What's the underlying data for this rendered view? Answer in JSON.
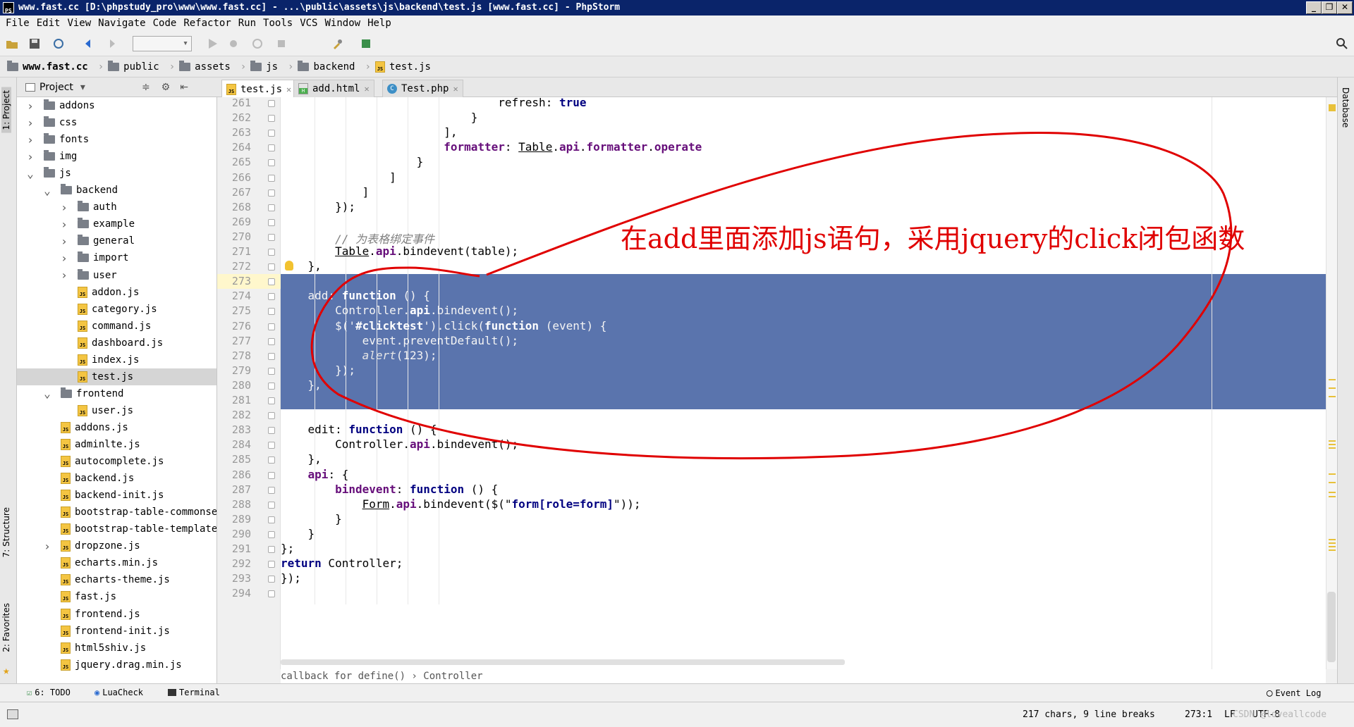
{
  "window": {
    "title": "www.fast.cc [D:\\phpstudy_pro\\www\\www.fast.cc] - ...\\public\\assets\\js\\backend\\test.js [www.fast.cc] - PhpStorm",
    "buttons": [
      "_",
      "❐",
      "✕"
    ]
  },
  "menu": [
    "File",
    "Edit",
    "View",
    "Navigate",
    "Code",
    "Refactor",
    "Run",
    "Tools",
    "VCS",
    "Window",
    "Help"
  ],
  "breadcrumbs": [
    "www.fast.cc",
    "public",
    "assets",
    "js",
    "backend",
    "test.js"
  ],
  "project_panel": {
    "title": "Project",
    "tree": [
      {
        "label": "addons",
        "type": "folder",
        "depth": 0,
        "arrow": "›"
      },
      {
        "label": "css",
        "type": "folder",
        "depth": 0,
        "arrow": "›"
      },
      {
        "label": "fonts",
        "type": "folder",
        "depth": 0,
        "arrow": "›"
      },
      {
        "label": "img",
        "type": "folder",
        "depth": 0,
        "arrow": "›"
      },
      {
        "label": "js",
        "type": "folder",
        "depth": 0,
        "arrow": "⌄"
      },
      {
        "label": "backend",
        "type": "folder",
        "depth": 1,
        "arrow": "⌄"
      },
      {
        "label": "auth",
        "type": "folder",
        "depth": 2,
        "arrow": "›"
      },
      {
        "label": "example",
        "type": "folder",
        "depth": 2,
        "arrow": "›"
      },
      {
        "label": "general",
        "type": "folder",
        "depth": 2,
        "arrow": "›"
      },
      {
        "label": "import",
        "type": "folder",
        "depth": 2,
        "arrow": "›"
      },
      {
        "label": "user",
        "type": "folder",
        "depth": 2,
        "arrow": "›"
      },
      {
        "label": "addon.js",
        "type": "js",
        "depth": 2,
        "arrow": ""
      },
      {
        "label": "category.js",
        "type": "js",
        "depth": 2,
        "arrow": ""
      },
      {
        "label": "command.js",
        "type": "js",
        "depth": 2,
        "arrow": ""
      },
      {
        "label": "dashboard.js",
        "type": "js",
        "depth": 2,
        "arrow": ""
      },
      {
        "label": "index.js",
        "type": "js",
        "depth": 2,
        "arrow": ""
      },
      {
        "label": "test.js",
        "type": "js",
        "depth": 2,
        "arrow": "",
        "selected": true
      },
      {
        "label": "frontend",
        "type": "folder",
        "depth": 1,
        "arrow": "⌄"
      },
      {
        "label": "user.js",
        "type": "js",
        "depth": 2,
        "arrow": ""
      },
      {
        "label": "addons.js",
        "type": "js",
        "depth": 1,
        "arrow": ""
      },
      {
        "label": "adminlte.js",
        "type": "js",
        "depth": 1,
        "arrow": ""
      },
      {
        "label": "autocomplete.js",
        "type": "js",
        "depth": 1,
        "arrow": ""
      },
      {
        "label": "backend.js",
        "type": "js",
        "depth": 1,
        "arrow": ""
      },
      {
        "label": "backend-init.js",
        "type": "js",
        "depth": 1,
        "arrow": ""
      },
      {
        "label": "bootstrap-table-commonse",
        "type": "js",
        "depth": 1,
        "arrow": ""
      },
      {
        "label": "bootstrap-table-template",
        "type": "js",
        "depth": 1,
        "arrow": ""
      },
      {
        "label": "dropzone.js",
        "type": "js",
        "depth": 1,
        "arrow": "›"
      },
      {
        "label": "echarts.min.js",
        "type": "jsmin",
        "depth": 1,
        "arrow": ""
      },
      {
        "label": "echarts-theme.js",
        "type": "js",
        "depth": 1,
        "arrow": ""
      },
      {
        "label": "fast.js",
        "type": "js",
        "depth": 1,
        "arrow": ""
      },
      {
        "label": "frontend.js",
        "type": "js",
        "depth": 1,
        "arrow": ""
      },
      {
        "label": "frontend-init.js",
        "type": "js",
        "depth": 1,
        "arrow": ""
      },
      {
        "label": "html5shiv.js",
        "type": "js",
        "depth": 1,
        "arrow": ""
      },
      {
        "label": "jquery.drag.min.js",
        "type": "jsmin",
        "depth": 1,
        "arrow": ""
      }
    ]
  },
  "left_tool_tabs": [
    "1: Project",
    "7: Structure",
    "2: Favorites"
  ],
  "right_tool_tabs": [
    "Database"
  ],
  "tabs": [
    {
      "label": "test.js",
      "active": true,
      "icon": "js"
    },
    {
      "label": "add.html",
      "active": false,
      "icon": "html"
    },
    {
      "label": "Test.php",
      "active": false,
      "icon": "php"
    }
  ],
  "editor": {
    "lines": [
      {
        "n": "261",
        "html": "                                refresh: true",
        "parts": [
          [
            "                                ",
            ""
          ],
          [
            "refresh",
            ""
          ],
          [
            ": ",
            ""
          ],
          [
            "true",
            "kw"
          ]
        ]
      },
      {
        "n": "262",
        "parts": [
          [
            "                            }",
            ""
          ]
        ]
      },
      {
        "n": "263",
        "parts": [
          [
            "                        ],",
            ""
          ]
        ]
      },
      {
        "n": "264",
        "parts": [
          [
            "                        ",
            ""
          ],
          [
            "formatter",
            "prop"
          ],
          [
            ": ",
            ""
          ],
          [
            "Table",
            "ul"
          ],
          [
            ".",
            ""
          ],
          [
            "api",
            "prop"
          ],
          [
            ".",
            ""
          ],
          [
            "formatter",
            "prop"
          ],
          [
            ".",
            ""
          ],
          [
            "operate",
            "prop"
          ]
        ]
      },
      {
        "n": "265",
        "parts": [
          [
            "                    }",
            ""
          ]
        ]
      },
      {
        "n": "266",
        "parts": [
          [
            "                ]",
            ""
          ]
        ]
      },
      {
        "n": "267",
        "parts": [
          [
            "            ]",
            ""
          ]
        ]
      },
      {
        "n": "268",
        "parts": [
          [
            "        });",
            ""
          ]
        ]
      },
      {
        "n": "269",
        "parts": [
          [
            "",
            ""
          ]
        ]
      },
      {
        "n": "270",
        "parts": [
          [
            "        ",
            ""
          ],
          [
            "// 为表格绑定事件",
            "cm"
          ]
        ]
      },
      {
        "n": "271",
        "parts": [
          [
            "        ",
            ""
          ],
          [
            "Table",
            "ul"
          ],
          [
            ".",
            ""
          ],
          [
            "api",
            "prop"
          ],
          [
            ".bindevent(table);",
            ""
          ]
        ]
      },
      {
        "n": "272",
        "parts": [
          [
            "    },",
            ""
          ]
        ]
      },
      {
        "n": "273",
        "parts": [
          [
            "",
            ""
          ]
        ]
      },
      {
        "n": "274",
        "parts": [
          [
            "    add: ",
            ""
          ],
          [
            "function",
            "kw"
          ],
          [
            " () {",
            ""
          ]
        ]
      },
      {
        "n": "275",
        "parts": [
          [
            "        Controller.",
            ""
          ],
          [
            "api",
            "kw"
          ],
          [
            ".bindevent();",
            ""
          ]
        ]
      },
      {
        "n": "276",
        "parts": [
          [
            "        $('",
            ""
          ],
          [
            "#clicktest",
            "kw"
          ],
          [
            "').click(",
            ""
          ],
          [
            "function",
            "kw"
          ],
          [
            " (event) {",
            ""
          ]
        ]
      },
      {
        "n": "277",
        "parts": [
          [
            "            event.preventDefault();",
            ""
          ]
        ]
      },
      {
        "n": "278",
        "parts": [
          [
            "            ",
            ""
          ],
          [
            "alert",
            "cm"
          ],
          [
            "(123);",
            ""
          ]
        ]
      },
      {
        "n": "279",
        "parts": [
          [
            "        });",
            ""
          ]
        ]
      },
      {
        "n": "280",
        "parts": [
          [
            "    },",
            ""
          ]
        ]
      },
      {
        "n": "281",
        "parts": [
          [
            "",
            ""
          ]
        ]
      },
      {
        "n": "282",
        "parts": [
          [
            "",
            ""
          ]
        ]
      },
      {
        "n": "283",
        "parts": [
          [
            "    edit: ",
            ""
          ],
          [
            "function",
            "kw"
          ],
          [
            " () {",
            ""
          ]
        ]
      },
      {
        "n": "284",
        "parts": [
          [
            "        Controller.",
            ""
          ],
          [
            "api",
            "prop"
          ],
          [
            ".bindevent();",
            ""
          ]
        ]
      },
      {
        "n": "285",
        "parts": [
          [
            "    },",
            ""
          ]
        ]
      },
      {
        "n": "286",
        "parts": [
          [
            "    ",
            ""
          ],
          [
            "api",
            "prop"
          ],
          [
            ": {",
            ""
          ]
        ]
      },
      {
        "n": "287",
        "parts": [
          [
            "        ",
            ""
          ],
          [
            "bindevent",
            "prop"
          ],
          [
            ": ",
            ""
          ],
          [
            "function",
            "kw"
          ],
          [
            " () {",
            ""
          ]
        ]
      },
      {
        "n": "288",
        "parts": [
          [
            "            ",
            ""
          ],
          [
            "Form",
            "ul"
          ],
          [
            ".",
            ""
          ],
          [
            "api",
            "prop"
          ],
          [
            ".bindevent($(\"",
            ""
          ],
          [
            "form[role=form]",
            "kw"
          ],
          [
            "\"));",
            ""
          ]
        ]
      },
      {
        "n": "289",
        "parts": [
          [
            "        }",
            ""
          ]
        ]
      },
      {
        "n": "290",
        "parts": [
          [
            "    }",
            ""
          ]
        ]
      },
      {
        "n": "291",
        "parts": [
          [
            "};",
            ""
          ]
        ]
      },
      {
        "n": "292",
        "parts": [
          [
            "",
            ""
          ],
          [
            "return",
            "kw"
          ],
          [
            " Controller;",
            ""
          ]
        ]
      },
      {
        "n": "293",
        "parts": [
          [
            "});",
            ""
          ]
        ]
      },
      {
        "n": "294",
        "parts": [
          [
            "",
            ""
          ]
        ]
      }
    ],
    "code_breadcrumb": "callback for define()  › Controller"
  },
  "annotation": "在add里面添加js语句，采用jquery的click闭包函数",
  "bottom_tools": [
    "6: TODO",
    "LuaCheck",
    "Terminal",
    "Event Log"
  ],
  "status": {
    "chars": "217 chars, 9 line breaks",
    "position": "273:1",
    "line_sep": "LF",
    "encoding": "UTF-8",
    "watermark": "CSDN @loveallcode"
  },
  "colors": {
    "selection": "#5a74ad",
    "annotation": "#e00000",
    "titlebar": "#0a246a"
  }
}
